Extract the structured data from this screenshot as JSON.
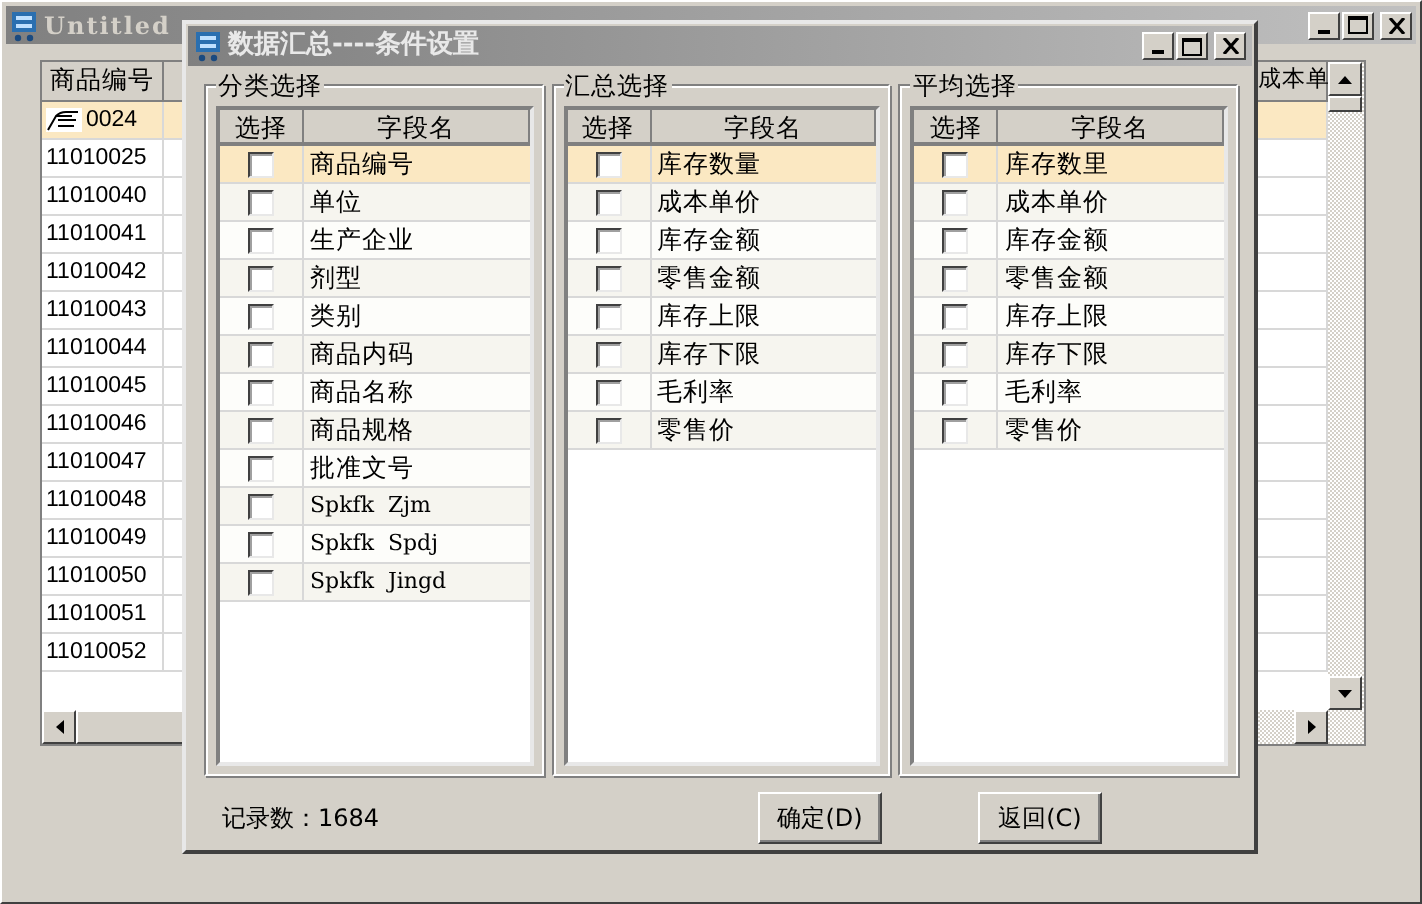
{
  "main_window": {
    "title": "Untitled",
    "columns": [
      "商品编号",
      "成本单"
    ],
    "rows": [
      {
        "code": "0024",
        "selected": true
      },
      {
        "code": "11010025",
        "selected": false
      },
      {
        "code": "11010040",
        "selected": false
      },
      {
        "code": "11010041",
        "selected": false
      },
      {
        "code": "11010042",
        "selected": false
      },
      {
        "code": "11010043",
        "selected": false
      },
      {
        "code": "11010044",
        "selected": false
      },
      {
        "code": "11010045",
        "selected": false
      },
      {
        "code": "11010046",
        "selected": false
      },
      {
        "code": "11010047",
        "selected": false
      },
      {
        "code": "11010048",
        "selected": false
      },
      {
        "code": "11010049",
        "selected": false
      },
      {
        "code": "11010050",
        "selected": false
      },
      {
        "code": "11010051",
        "selected": false
      },
      {
        "code": "11010052",
        "selected": false
      }
    ]
  },
  "dialog": {
    "title": "数据汇总----条件设置",
    "groups": [
      {
        "title": "分类选择",
        "columns": [
          "选择",
          "字段名"
        ],
        "items": [
          {
            "label": "商品编号",
            "checked": false,
            "selected": true
          },
          {
            "label": "单位",
            "checked": false,
            "selected": false
          },
          {
            "label": "生产企业",
            "checked": false,
            "selected": false
          },
          {
            "label": "剂型",
            "checked": false,
            "selected": false
          },
          {
            "label": "类别",
            "checked": false,
            "selected": false
          },
          {
            "label": "商品内码",
            "checked": false,
            "selected": false
          },
          {
            "label": "商品名称",
            "checked": false,
            "selected": false
          },
          {
            "label": "商品规格",
            "checked": false,
            "selected": false
          },
          {
            "label": "批准文号",
            "checked": false,
            "selected": false
          },
          {
            "label": "Spkfk  Zjm",
            "checked": false,
            "selected": false
          },
          {
            "label": "Spkfk  Spdj",
            "checked": false,
            "selected": false
          },
          {
            "label": "Spkfk  Jingd",
            "checked": false,
            "selected": false
          }
        ]
      },
      {
        "title": "汇总选择",
        "columns": [
          "选择",
          "字段名"
        ],
        "items": [
          {
            "label": "库存数量",
            "checked": false,
            "selected": true
          },
          {
            "label": "成本单价",
            "checked": false,
            "selected": false
          },
          {
            "label": "库存金额",
            "checked": false,
            "selected": false
          },
          {
            "label": "零售金额",
            "checked": false,
            "selected": false
          },
          {
            "label": "库存上限",
            "checked": false,
            "selected": false
          },
          {
            "label": "库存下限",
            "checked": false,
            "selected": false
          },
          {
            "label": "毛利率",
            "checked": false,
            "selected": false
          },
          {
            "label": "零售价",
            "checked": false,
            "selected": false
          }
        ]
      },
      {
        "title": "平均选择",
        "columns": [
          "选择",
          "字段名"
        ],
        "items": [
          {
            "label": "库存数里",
            "checked": false,
            "selected": true
          },
          {
            "label": "成本单价",
            "checked": false,
            "selected": false
          },
          {
            "label": "库存金额",
            "checked": false,
            "selected": false
          },
          {
            "label": "零售金额",
            "checked": false,
            "selected": false
          },
          {
            "label": "库存上限",
            "checked": false,
            "selected": false
          },
          {
            "label": "库存下限",
            "checked": false,
            "selected": false
          },
          {
            "label": "毛利率",
            "checked": false,
            "selected": false
          },
          {
            "label": "零售价",
            "checked": false,
            "selected": false
          }
        ]
      }
    ],
    "record_count": "记录数：1684",
    "buttons": [
      "确定(D)",
      "返回(C)"
    ]
  }
}
